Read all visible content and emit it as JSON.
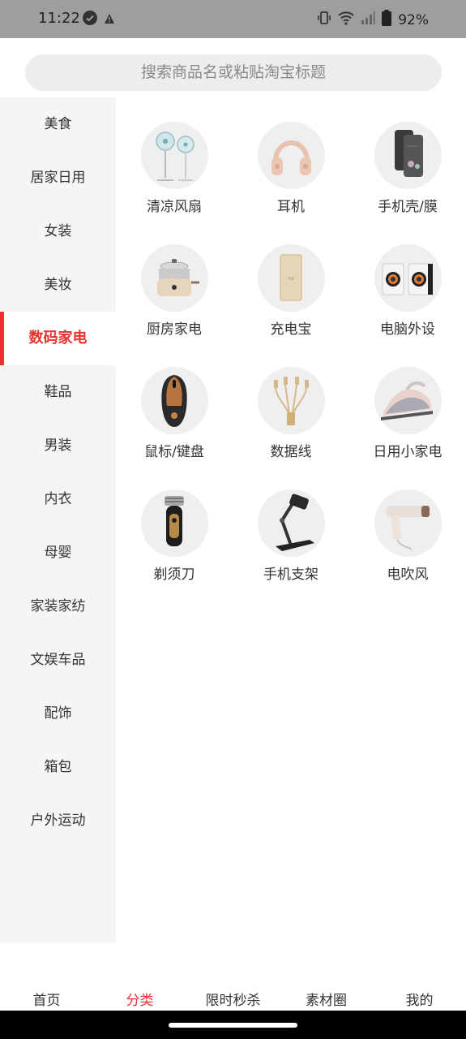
{
  "status_bar": {
    "time": "11:22",
    "battery": "92%",
    "icons": [
      "check-circle-icon",
      "alert-triangle-icon",
      "vibrate-icon",
      "wifi-icon",
      "signal-icon",
      "battery-icon"
    ]
  },
  "search": {
    "placeholder": "搜索商品名或粘贴淘宝标题"
  },
  "sidebar": {
    "active_index": 4,
    "accent_color": "#e8332e",
    "items": [
      {
        "label": "美食"
      },
      {
        "label": "居家日用"
      },
      {
        "label": "女装"
      },
      {
        "label": "美妆"
      },
      {
        "label": "数码家电"
      },
      {
        "label": "鞋品"
      },
      {
        "label": "男装"
      },
      {
        "label": "内衣"
      },
      {
        "label": "母婴"
      },
      {
        "label": "家装家纺"
      },
      {
        "label": "文娱车品"
      },
      {
        "label": "配饰"
      },
      {
        "label": "箱包"
      },
      {
        "label": "户外运动"
      }
    ]
  },
  "categories": [
    {
      "label": "清凉风扇",
      "icon": "fan-icon"
    },
    {
      "label": "耳机",
      "icon": "headphones-icon"
    },
    {
      "label": "手机壳/膜",
      "icon": "phone-case-icon"
    },
    {
      "label": "厨房家电",
      "icon": "cooker-icon"
    },
    {
      "label": "充电宝",
      "icon": "power-bank-icon"
    },
    {
      "label": "电脑外设",
      "icon": "speakers-icon"
    },
    {
      "label": "鼠标/键盘",
      "icon": "mouse-icon"
    },
    {
      "label": "数据线",
      "icon": "cable-icon"
    },
    {
      "label": "日用小家电",
      "icon": "iron-icon"
    },
    {
      "label": "剃须刀",
      "icon": "shaver-icon"
    },
    {
      "label": "手机支架",
      "icon": "phone-stand-icon"
    },
    {
      "label": "电吹风",
      "icon": "hair-dryer-icon"
    }
  ],
  "bottom_nav": {
    "active_index": 1,
    "items": [
      {
        "label": "首页"
      },
      {
        "label": "分类"
      },
      {
        "label": "限时秒杀"
      },
      {
        "label": "素材圈"
      },
      {
        "label": "我的"
      }
    ]
  }
}
